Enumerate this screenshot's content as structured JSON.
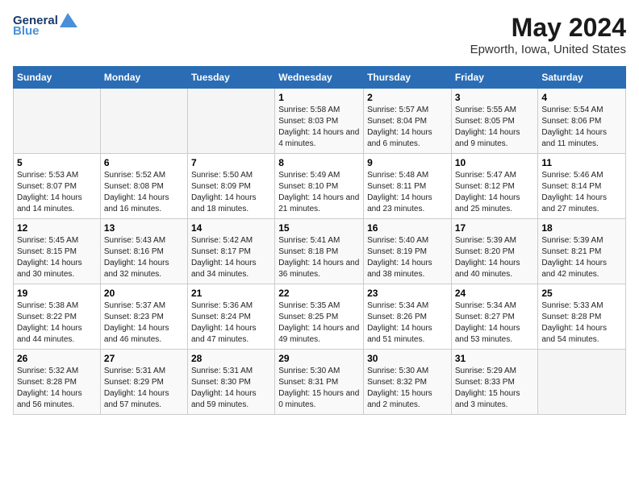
{
  "header": {
    "logo_line1": "General",
    "logo_line2": "Blue",
    "title": "May 2024",
    "subtitle": "Epworth, Iowa, United States"
  },
  "days_of_week": [
    "Sunday",
    "Monday",
    "Tuesday",
    "Wednesday",
    "Thursday",
    "Friday",
    "Saturday"
  ],
  "weeks": [
    [
      {
        "day": "",
        "sunrise": "",
        "sunset": "",
        "daylight": ""
      },
      {
        "day": "",
        "sunrise": "",
        "sunset": "",
        "daylight": ""
      },
      {
        "day": "",
        "sunrise": "",
        "sunset": "",
        "daylight": ""
      },
      {
        "day": "1",
        "sunrise": "Sunrise: 5:58 AM",
        "sunset": "Sunset: 8:03 PM",
        "daylight": "Daylight: 14 hours and 4 minutes."
      },
      {
        "day": "2",
        "sunrise": "Sunrise: 5:57 AM",
        "sunset": "Sunset: 8:04 PM",
        "daylight": "Daylight: 14 hours and 6 minutes."
      },
      {
        "day": "3",
        "sunrise": "Sunrise: 5:55 AM",
        "sunset": "Sunset: 8:05 PM",
        "daylight": "Daylight: 14 hours and 9 minutes."
      },
      {
        "day": "4",
        "sunrise": "Sunrise: 5:54 AM",
        "sunset": "Sunset: 8:06 PM",
        "daylight": "Daylight: 14 hours and 11 minutes."
      }
    ],
    [
      {
        "day": "5",
        "sunrise": "Sunrise: 5:53 AM",
        "sunset": "Sunset: 8:07 PM",
        "daylight": "Daylight: 14 hours and 14 minutes."
      },
      {
        "day": "6",
        "sunrise": "Sunrise: 5:52 AM",
        "sunset": "Sunset: 8:08 PM",
        "daylight": "Daylight: 14 hours and 16 minutes."
      },
      {
        "day": "7",
        "sunrise": "Sunrise: 5:50 AM",
        "sunset": "Sunset: 8:09 PM",
        "daylight": "Daylight: 14 hours and 18 minutes."
      },
      {
        "day": "8",
        "sunrise": "Sunrise: 5:49 AM",
        "sunset": "Sunset: 8:10 PM",
        "daylight": "Daylight: 14 hours and 21 minutes."
      },
      {
        "day": "9",
        "sunrise": "Sunrise: 5:48 AM",
        "sunset": "Sunset: 8:11 PM",
        "daylight": "Daylight: 14 hours and 23 minutes."
      },
      {
        "day": "10",
        "sunrise": "Sunrise: 5:47 AM",
        "sunset": "Sunset: 8:12 PM",
        "daylight": "Daylight: 14 hours and 25 minutes."
      },
      {
        "day": "11",
        "sunrise": "Sunrise: 5:46 AM",
        "sunset": "Sunset: 8:14 PM",
        "daylight": "Daylight: 14 hours and 27 minutes."
      }
    ],
    [
      {
        "day": "12",
        "sunrise": "Sunrise: 5:45 AM",
        "sunset": "Sunset: 8:15 PM",
        "daylight": "Daylight: 14 hours and 30 minutes."
      },
      {
        "day": "13",
        "sunrise": "Sunrise: 5:43 AM",
        "sunset": "Sunset: 8:16 PM",
        "daylight": "Daylight: 14 hours and 32 minutes."
      },
      {
        "day": "14",
        "sunrise": "Sunrise: 5:42 AM",
        "sunset": "Sunset: 8:17 PM",
        "daylight": "Daylight: 14 hours and 34 minutes."
      },
      {
        "day": "15",
        "sunrise": "Sunrise: 5:41 AM",
        "sunset": "Sunset: 8:18 PM",
        "daylight": "Daylight: 14 hours and 36 minutes."
      },
      {
        "day": "16",
        "sunrise": "Sunrise: 5:40 AM",
        "sunset": "Sunset: 8:19 PM",
        "daylight": "Daylight: 14 hours and 38 minutes."
      },
      {
        "day": "17",
        "sunrise": "Sunrise: 5:39 AM",
        "sunset": "Sunset: 8:20 PM",
        "daylight": "Daylight: 14 hours and 40 minutes."
      },
      {
        "day": "18",
        "sunrise": "Sunrise: 5:39 AM",
        "sunset": "Sunset: 8:21 PM",
        "daylight": "Daylight: 14 hours and 42 minutes."
      }
    ],
    [
      {
        "day": "19",
        "sunrise": "Sunrise: 5:38 AM",
        "sunset": "Sunset: 8:22 PM",
        "daylight": "Daylight: 14 hours and 44 minutes."
      },
      {
        "day": "20",
        "sunrise": "Sunrise: 5:37 AM",
        "sunset": "Sunset: 8:23 PM",
        "daylight": "Daylight: 14 hours and 46 minutes."
      },
      {
        "day": "21",
        "sunrise": "Sunrise: 5:36 AM",
        "sunset": "Sunset: 8:24 PM",
        "daylight": "Daylight: 14 hours and 47 minutes."
      },
      {
        "day": "22",
        "sunrise": "Sunrise: 5:35 AM",
        "sunset": "Sunset: 8:25 PM",
        "daylight": "Daylight: 14 hours and 49 minutes."
      },
      {
        "day": "23",
        "sunrise": "Sunrise: 5:34 AM",
        "sunset": "Sunset: 8:26 PM",
        "daylight": "Daylight: 14 hours and 51 minutes."
      },
      {
        "day": "24",
        "sunrise": "Sunrise: 5:34 AM",
        "sunset": "Sunset: 8:27 PM",
        "daylight": "Daylight: 14 hours and 53 minutes."
      },
      {
        "day": "25",
        "sunrise": "Sunrise: 5:33 AM",
        "sunset": "Sunset: 8:28 PM",
        "daylight": "Daylight: 14 hours and 54 minutes."
      }
    ],
    [
      {
        "day": "26",
        "sunrise": "Sunrise: 5:32 AM",
        "sunset": "Sunset: 8:28 PM",
        "daylight": "Daylight: 14 hours and 56 minutes."
      },
      {
        "day": "27",
        "sunrise": "Sunrise: 5:31 AM",
        "sunset": "Sunset: 8:29 PM",
        "daylight": "Daylight: 14 hours and 57 minutes."
      },
      {
        "day": "28",
        "sunrise": "Sunrise: 5:31 AM",
        "sunset": "Sunset: 8:30 PM",
        "daylight": "Daylight: 14 hours and 59 minutes."
      },
      {
        "day": "29",
        "sunrise": "Sunrise: 5:30 AM",
        "sunset": "Sunset: 8:31 PM",
        "daylight": "Daylight: 15 hours and 0 minutes."
      },
      {
        "day": "30",
        "sunrise": "Sunrise: 5:30 AM",
        "sunset": "Sunset: 8:32 PM",
        "daylight": "Daylight: 15 hours and 2 minutes."
      },
      {
        "day": "31",
        "sunrise": "Sunrise: 5:29 AM",
        "sunset": "Sunset: 8:33 PM",
        "daylight": "Daylight: 15 hours and 3 minutes."
      },
      {
        "day": "",
        "sunrise": "",
        "sunset": "",
        "daylight": ""
      }
    ]
  ]
}
